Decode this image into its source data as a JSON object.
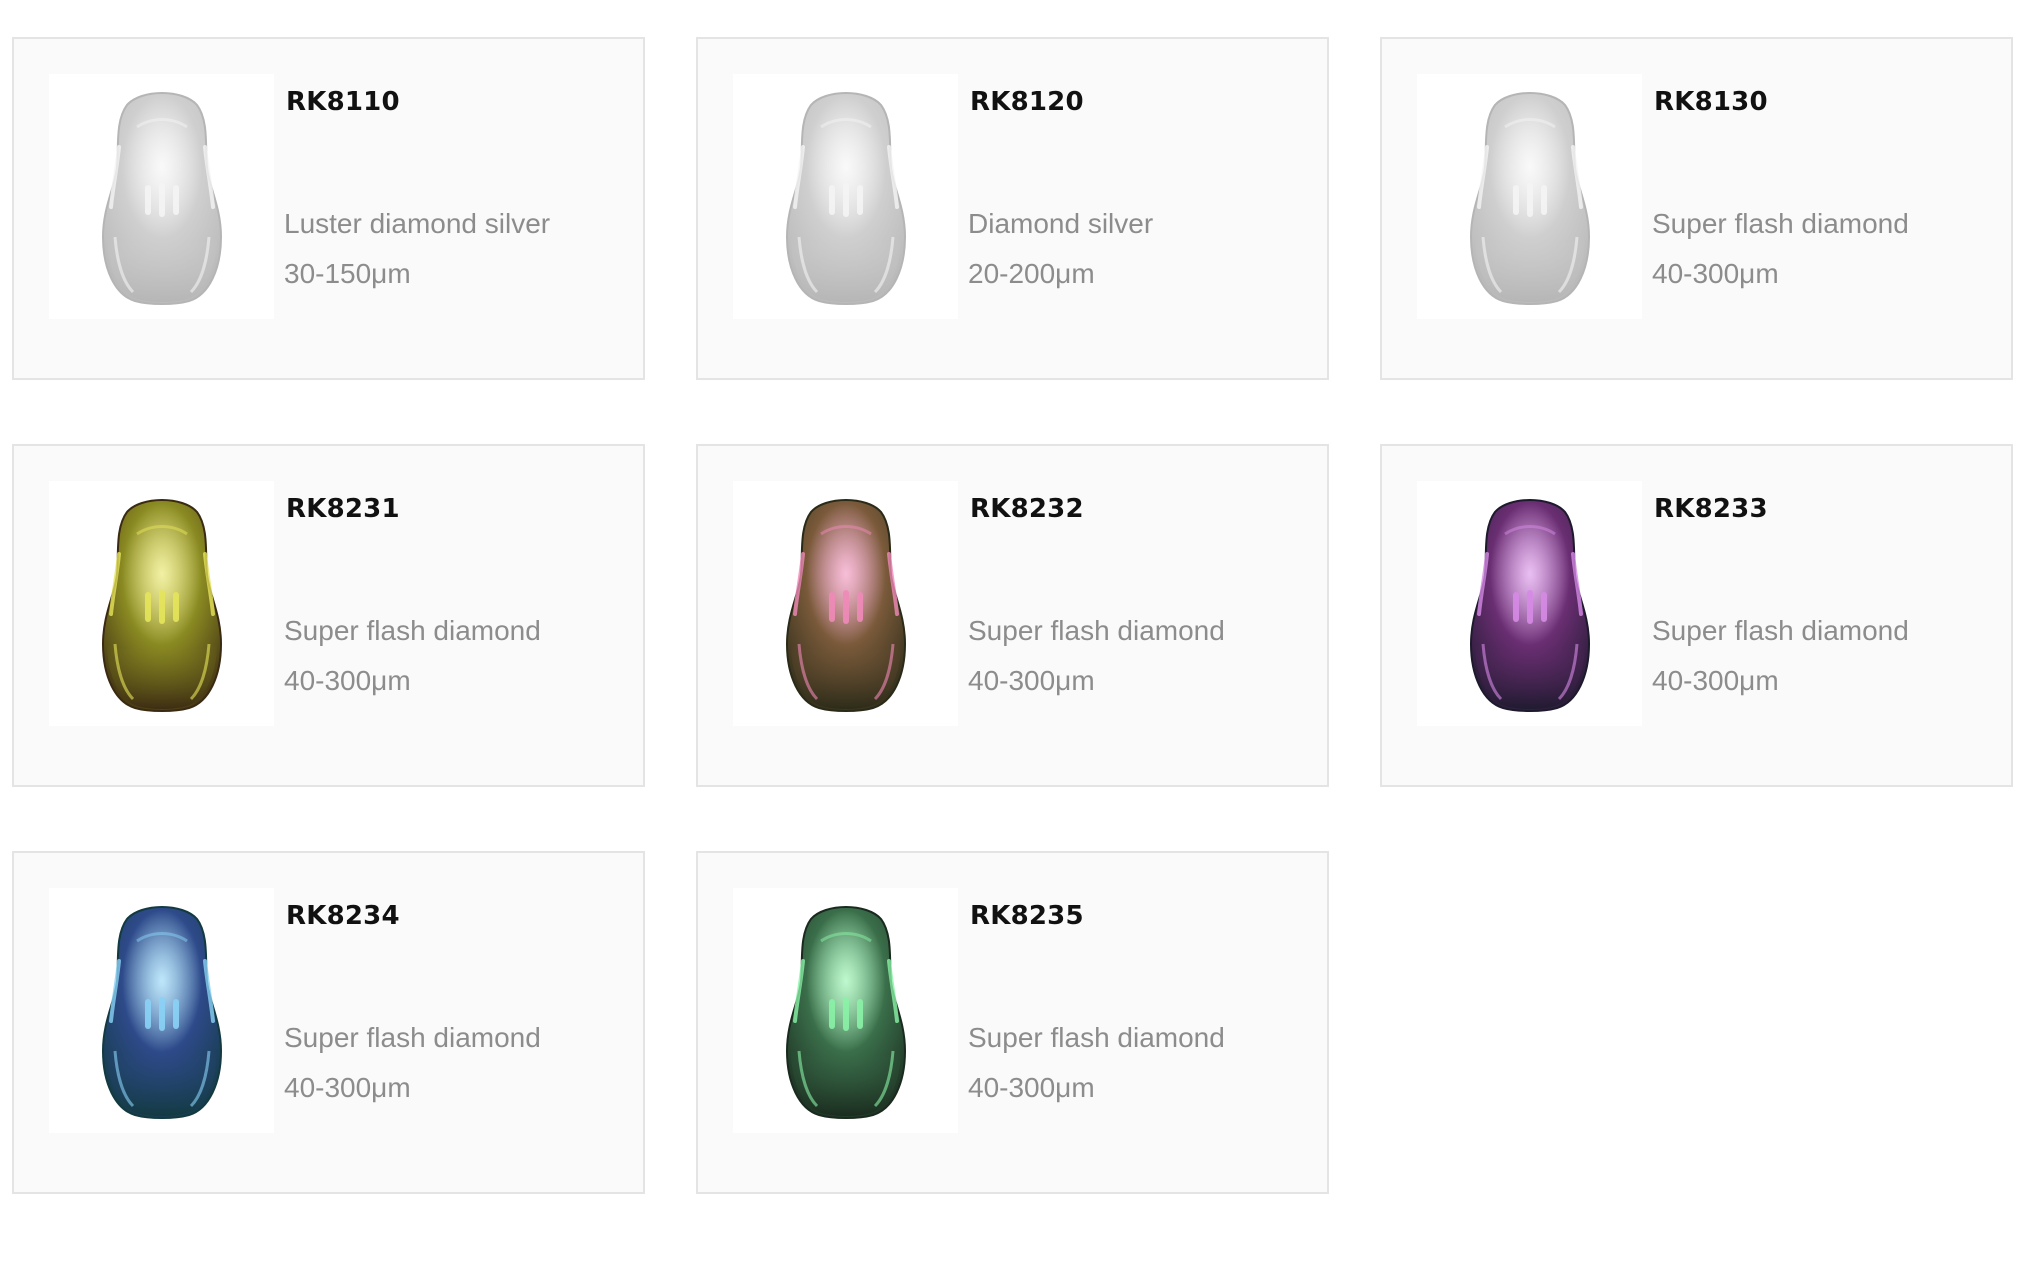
{
  "products": [
    {
      "code": "RK8110",
      "name": "Luster diamond silver",
      "size": "30-150μm",
      "color": "#cfcfcf",
      "accent": "#f4f4f4",
      "dark": "#b5b5b5"
    },
    {
      "code": "RK8120",
      "name": "Diamond silver",
      "size": "20-200μm",
      "color": "#cfcfcf",
      "accent": "#f4f4f4",
      "dark": "#b5b5b5"
    },
    {
      "code": "RK8130",
      "name": "Super flash diamond",
      "size": "40-300μm",
      "color": "#cfcfcf",
      "accent": "#f4f4f4",
      "dark": "#b5b5b5"
    },
    {
      "code": "RK8231",
      "name": "Super flash diamond",
      "size": "40-300μm",
      "color": "#8a8a22",
      "accent": "#e6e45a",
      "dark": "#3a2a12"
    },
    {
      "code": "RK8232",
      "name": "Super flash diamond",
      "size": "40-300μm",
      "color": "#7a5a3a",
      "accent": "#f08ab8",
      "dark": "#2a2a18"
    },
    {
      "code": "RK8233",
      "name": "Super flash diamond",
      "size": "40-300μm",
      "color": "#6a2e72",
      "accent": "#d68ae6",
      "dark": "#1e1a2e"
    },
    {
      "code": "RK8234",
      "name": "Super flash diamond",
      "size": "40-300μm",
      "color": "#2e4a8a",
      "accent": "#8ad2f6",
      "dark": "#123a40"
    },
    {
      "code": "RK8235",
      "name": "Super flash diamond",
      "size": "40-300μm",
      "color": "#3a6e4a",
      "accent": "#8af2a6",
      "dark": "#1a2a1e"
    }
  ]
}
